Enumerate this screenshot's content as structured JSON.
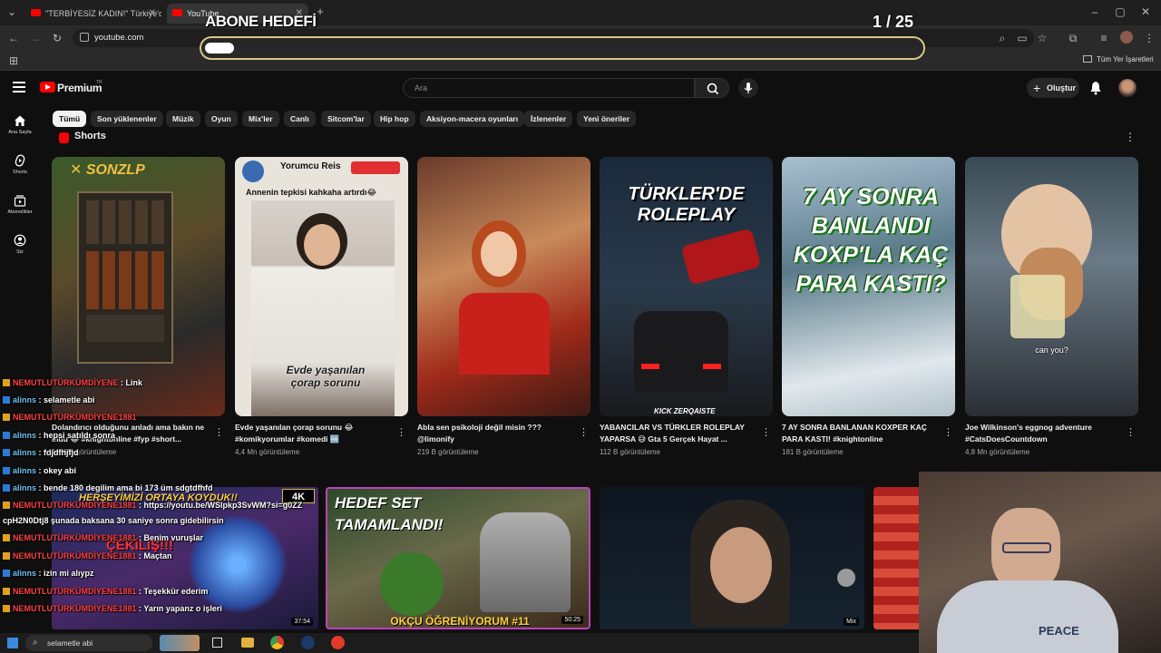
{
  "browser": {
    "tabs": [
      {
        "label": "\"TERBİYESİZ KADIN!\" Türkiye'd",
        "active": false
      },
      {
        "label": "YouTube",
        "active": true
      }
    ],
    "url": "youtube.com",
    "bookmarks_label": "Tüm Yer İşaretleri"
  },
  "overlay": {
    "goal_title": "ABONE HEDEFİ",
    "goal_count": "1 / 25",
    "goal_progress": 0.04
  },
  "youtube": {
    "logo": "Premium",
    "logo_sup": "TR",
    "search_placeholder": "Ara",
    "create_label": "Oluştur",
    "chips": [
      "Tümü",
      "Son yüklenenler",
      "Müzik",
      "Oyun",
      "Mix'ler",
      "Canlı",
      "Sitcom'lar",
      "Hip hop",
      "Aksiyon-macera oyunları",
      "İzlenenler",
      "Yeni öneriler"
    ],
    "sidebar": [
      {
        "label": "Ana Sayfa",
        "icon": "home-icon"
      },
      {
        "label": "Shorts",
        "icon": "shorts-icon"
      },
      {
        "label": "Abonelikler",
        "icon": "subscriptions-icon"
      },
      {
        "label": "Siz",
        "icon": "account-icon"
      }
    ],
    "shorts_header": "Shorts",
    "shorts": [
      {
        "title": "Dolandırıcı olduğunu anladı ama bakın ne oldu 😂 #knightonline #fyp #short...",
        "views": "1,1 Mn görüntüleme",
        "thumb_text": ""
      },
      {
        "title": "Evde yaşanılan çorap sorunu 😂 #komikyorumlar #komedi 🆓",
        "views": "4,4 Mn görüntüleme",
        "thumb_text": "Evde yaşanılan çorap sorunu",
        "thumb_top": "Yorumcu Reis",
        "thumb_sub": "Annenin tepkisi kahkaha artırdı😂"
      },
      {
        "title": "Abla sen psikoloji değil misin ??? @limonify",
        "views": "219 B görüntüleme",
        "thumb_text": ""
      },
      {
        "title": "YABANCILAR VS TÜRKLER ROLEPLAY YAPARSA 😅 Gta 5 Gerçek Hayat ...",
        "views": "112 B görüntüleme",
        "thumb_text": "TÜRKLER'DE ROLEPLAY",
        "thumb_sub": "KICK ZERQAISTE"
      },
      {
        "title": "7 AY SONRA BANLANAN KOXPER KAÇ PARA KASTI! #knightonline",
        "views": "181 B görüntüleme",
        "thumb_text": "7 AY SONRA BANLANDI KOXP'LA KAÇ PARA KASTI?"
      },
      {
        "title": "Joe Wilkinson's eggnog adventure #CatsDoesCountdown",
        "views": "4,8 Mn görüntüleme",
        "thumb_text": "can you?"
      }
    ],
    "videos": [
      {
        "thumb_text": "HERŞEYİMİZİ ORTAYA KOYDUK!!",
        "duration": "37:54",
        "badge": "4K",
        "sub": "ÇEKİLİŞ!!!"
      },
      {
        "thumb_text": "HEDEF SET TAMAMLANDI!",
        "duration": "50:25",
        "sub": "OKÇU ÖĞRENİYORUM #11"
      },
      {
        "thumb_text": "",
        "duration": "Mix"
      },
      {
        "thumb_text": "",
        "duration": ""
      }
    ]
  },
  "chat": [
    {
      "user": "NEMUTLUTÜRKÜMDİYENE",
      "msg": "Link",
      "red": true
    },
    {
      "user": "alinns",
      "msg": "selametle abi",
      "red": false
    },
    {
      "user": "NEMUTLUTÜRKÜMDİYENE1881",
      "msg": "",
      "red": true
    },
    {
      "user": "alinns",
      "msg": "hepsi satıldı sonra",
      "red": false
    },
    {
      "user": "alinns",
      "msg": "fdjdfhjfjd",
      "red": false
    },
    {
      "user": "alinns",
      "msg": "okey abi",
      "red": false
    },
    {
      "user": "alinns",
      "msg": "bende 180 degilim ama bi 173 üm sdgtdfhfd",
      "red": false
    },
    {
      "user": "NEMUTLUTÜRKÜMDİYENE1881",
      "msg": "https://youtu.be/WSlpkp3SvWM?si=g0ZZ",
      "red": true
    },
    {
      "user": "",
      "msg": "cpH2N0Dtj8 şunada baksana 30 saniye sonra gidebilirsin",
      "red": false
    },
    {
      "user": "NEMUTLUTÜRKÜMDİYENE1881",
      "msg": "Benim vuruşlar",
      "red": true
    },
    {
      "user": "NEMUTLUTÜRKÜMDİYENE1881",
      "msg": "Maçtan",
      "red": true
    },
    {
      "user": "alinns",
      "msg": "izin mi alıypz",
      "red": false
    },
    {
      "user": "NEMUTLUTÜRKÜMDİYENE1881",
      "msg": "Teşekkür ederim",
      "red": true
    },
    {
      "user": "NEMUTLUTÜRKÜMDİYENE1881",
      "msg": "Yarın yapanz o işleri",
      "red": true
    },
    {
      "user": "alinns",
      "msg": "selametle abi",
      "red": false
    }
  ],
  "taskbar": {
    "search_text": "selametle abi"
  },
  "webcam": {
    "shirt_text": "PEACE"
  },
  "colors": {
    "bg": "#0f0f0f",
    "accent": "#ff0000",
    "chip_bg": "#272727",
    "goal_border": "#d9c48c"
  }
}
